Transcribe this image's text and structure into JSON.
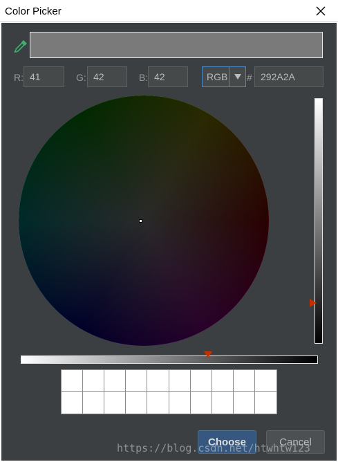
{
  "window": {
    "title": "Color Picker",
    "close_icon": "close-icon"
  },
  "current_color": {
    "hex": "#292A2A",
    "preview_hex": "#7a7a7a"
  },
  "fields": {
    "r_label": "R:",
    "r_value": "41",
    "g_label": "G:",
    "g_value": "42",
    "b_label": "B:",
    "b_value": "42",
    "mode_value": "RGB",
    "hash_label": "#",
    "hex_value": "292A2A"
  },
  "brightness_level": 0.16,
  "buttons": {
    "choose": "Choose",
    "cancel": "Cancel"
  },
  "watermark": "https://blog.csdn.net/htwhtw123",
  "icons": [
    "eyedropper-icon",
    "dropdown-arrow-icon",
    "close-icon"
  ]
}
